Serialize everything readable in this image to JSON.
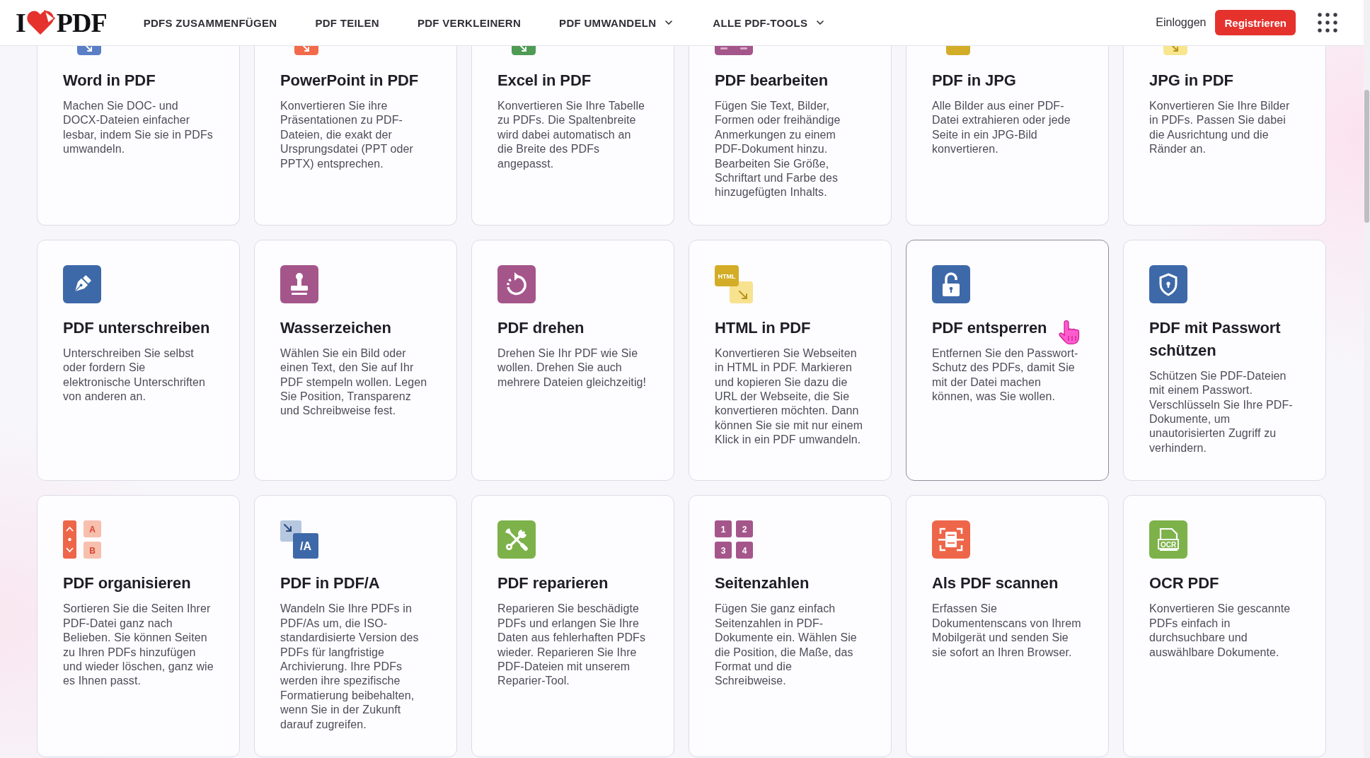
{
  "header": {
    "logo": {
      "left": "I",
      "right": "PDF"
    },
    "nav": [
      {
        "label": "PDFS ZUSAMMENFÜGEN",
        "dropdown": false
      },
      {
        "label": "PDF TEILEN",
        "dropdown": false
      },
      {
        "label": "PDF VERKLEINERN",
        "dropdown": false
      },
      {
        "label": "PDF UMWANDELN",
        "dropdown": true
      },
      {
        "label": "ALLE PDF-TOOLS",
        "dropdown": true
      }
    ],
    "login": "Einloggen",
    "register": "Registrieren"
  },
  "tools": [
    {
      "kind": "word",
      "title": "Word in PDF",
      "description": "Machen Sie DOC- und DOCX-Dateien einfacher lesbar, indem Sie sie in PDFs umwandeln.",
      "hovered": false
    },
    {
      "kind": "powerpoint",
      "title": "PowerPoint in PDF",
      "description": "Konvertieren Sie ihre Präsentationen zu PDF-Dateien, die exakt der Ursprungsdatei (PPT oder PPTX) entsprechen.",
      "hovered": false
    },
    {
      "kind": "excel",
      "title": "Excel in PDF",
      "description": "Konvertieren Sie Ihre Tabelle zu PDFs. Die Spaltenbreite wird dabei automatisch an die Breite des PDFs angepasst.",
      "hovered": false
    },
    {
      "kind": "edit",
      "title": "PDF bearbeiten",
      "description": "Fügen Sie Text, Bilder, Formen oder freihändige Anmerkungen zu einem PDF-Dokument hinzu. Bearbeiten Sie Größe, Schriftart und Farbe des hinzugefügten Inhalts.",
      "hovered": false
    },
    {
      "kind": "pdfjpg",
      "title": "PDF in JPG",
      "description": "Alle Bilder aus einer PDF-Datei extrahieren oder jede Seite in ein JPG-Bild konvertieren.",
      "hovered": false
    },
    {
      "kind": "jpgpdf",
      "title": "JPG in PDF",
      "description": "Konvertieren Sie Ihre Bilder in PDFs. Passen Sie dabei die Ausrichtung und die Ränder an.",
      "hovered": false
    },
    {
      "kind": "sign",
      "title": "PDF unterschreiben",
      "description": "Unterschreiben Sie selbst oder fordern Sie elektronische Unterschriften von anderen an.",
      "hovered": false
    },
    {
      "kind": "stamp",
      "title": "Wasserzeichen",
      "description": "Wählen Sie ein Bild oder einen Text, den Sie auf Ihr PDF stempeln wollen. Legen Sie Position, Transparenz und Schreibweise fest.",
      "hovered": false
    },
    {
      "kind": "rotate",
      "title": "PDF drehen",
      "description": "Drehen Sie Ihr PDF wie Sie wollen. Drehen Sie auch mehrere Dateien gleichzeitig!",
      "hovered": false
    },
    {
      "kind": "html",
      "icon_text": [
        "HTML"
      ],
      "title": "HTML in PDF",
      "description": "Konvertieren Sie Webseiten in HTML in PDF. Markieren und kopieren Sie dazu die URL der Webseite, die Sie konvertieren möchten. Dann können Sie sie mit nur einem Klick in ein PDF umwandeln.",
      "hovered": false
    },
    {
      "kind": "unlock",
      "title": "PDF entsperren",
      "description": "Entfernen Sie den Passwort-Schutz des PDFs, damit Sie mit der Datei machen können, was Sie wollen.",
      "hovered": true
    },
    {
      "kind": "shield",
      "title": "PDF mit Passwort schützen",
      "description": "Schützen Sie PDF-Dateien mit einem Passwort. Verschlüsseln Sie Ihre PDF-Dokumente, um unautorisierten Zugriff zu verhindern.",
      "hovered": false
    },
    {
      "kind": "organize",
      "icon_text": [
        "A",
        "B"
      ],
      "title": "PDF organisieren",
      "description": "Sortieren Sie die Seiten Ihrer PDF-Datei ganz nach Belieben. Sie können Seiten zu Ihren PDFs hinzufügen und wieder löschen, ganz wie es Ihnen passt.",
      "hovered": false
    },
    {
      "kind": "pdfa",
      "icon_text": [
        "/A"
      ],
      "title": "PDF in PDF/A",
      "description": "Wandeln Sie Ihre PDFs in PDF/As um, die ISO-standardisierte Version des PDFs für langfristige Archivierung. Ihre PDFs werden ihre spezifische Formatierung beibehalten, wenn Sie in der Zukunft darauf zugreifen.",
      "hovered": false
    },
    {
      "kind": "repair",
      "title": "PDF reparieren",
      "description": "Reparieren Sie beschädigte PDFs und erlangen Sie Ihre Daten aus fehlerhaften PDFs wieder. Reparieren Sie Ihre PDF-Dateien mit unserem Reparier-Tool.",
      "hovered": false
    },
    {
      "kind": "numbers",
      "icon_text": [
        "1",
        "2",
        "3",
        "4"
      ],
      "title": "Seitenzahlen",
      "description": "Fügen Sie ganz einfach Seitenzahlen in PDF-Dokumente ein. Wählen Sie die Position, die Maße, das Format und die Schreibweise.",
      "hovered": false
    },
    {
      "kind": "scan",
      "title": "Als PDF scannen",
      "description": "Erfassen Sie Dokumentenscans von Ihrem Mobilgerät und senden Sie sie sofort an Ihren Browser.",
      "hovered": false
    },
    {
      "kind": "ocr",
      "icon_text": [
        "OCR"
      ],
      "title": "OCR PDF",
      "description": "Konvertieren Sie gescannte PDFs einfach in durchsuchbare und auswählbare Dokumente.",
      "hovered": false
    }
  ]
}
